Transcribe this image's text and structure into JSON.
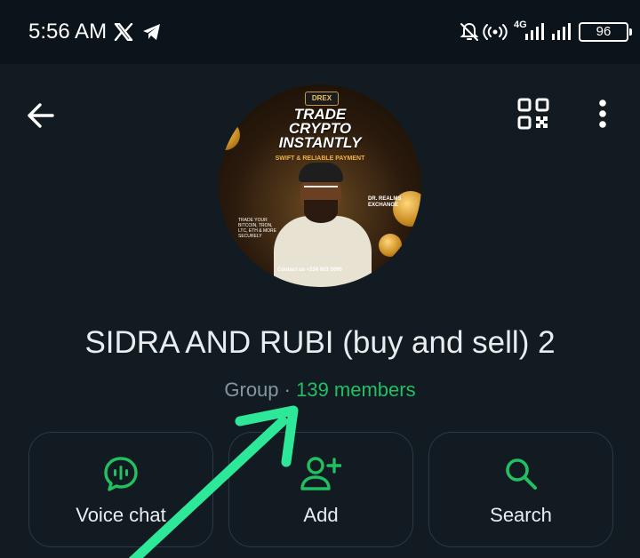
{
  "status_bar": {
    "time": "5:56 AM",
    "network": "4G",
    "battery": "96",
    "icons": [
      "x-icon",
      "telegram-icon",
      "mute-icon",
      "hotspot-icon",
      "signal-icon",
      "signal-icon"
    ]
  },
  "header": {
    "back_icon": "arrow-left-icon",
    "qr_icon": "qr-code-icon",
    "menu_icon": "more-vertical-icon"
  },
  "avatar": {
    "brand": "DREX",
    "headline_1": "TRADE",
    "headline_2": "CRYPTO",
    "headline_3": "INSTANTLY",
    "subline": "SWIFT & RELIABLE PAYMENT",
    "realms_1": "DR. REALMS",
    "realms_2": "EXCHANGE",
    "trade_note": "TRADE YOUR BITCOIN, TRON, LTC, ETH & MORE SECURELY",
    "contact": "Contact us  +234 903 5695"
  },
  "group": {
    "title": "SIDRA AND RUBI (buy and sell) 2",
    "type_label": "Group",
    "separator": " · ",
    "members": "139 members"
  },
  "actions": [
    {
      "label": "Voice chat",
      "icon": "voice-chat-icon"
    },
    {
      "label": "Add",
      "icon": "add-member-icon"
    },
    {
      "label": "Search",
      "icon": "search-icon"
    }
  ],
  "colors": {
    "accent": "#21c063",
    "background": "#111b21",
    "annotation_arrow": "#2ee89a"
  }
}
